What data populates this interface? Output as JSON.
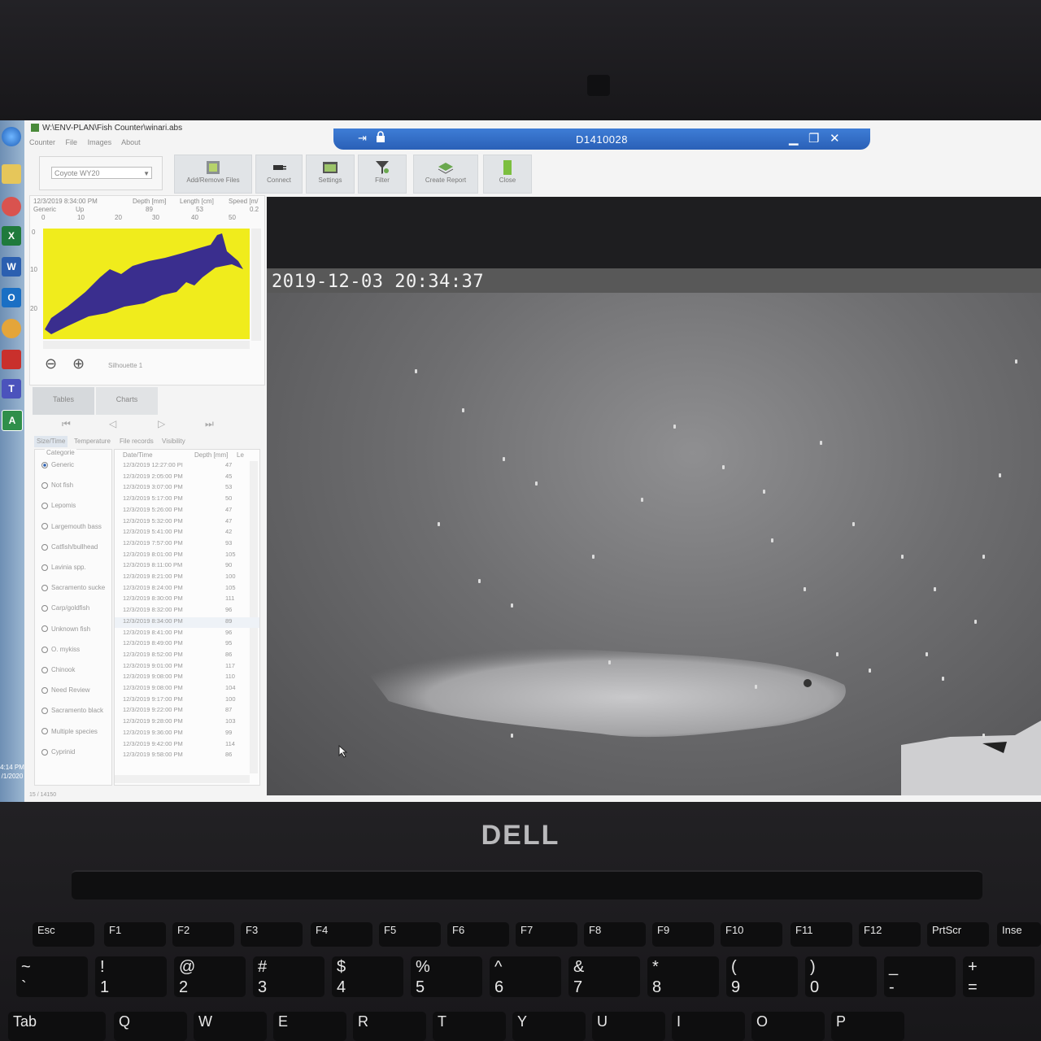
{
  "app": {
    "window_title": "W:\\ENV-PLAN\\Fish Counter\\winari.abs",
    "menu": [
      "Counter",
      "File",
      "Images",
      "About"
    ]
  },
  "remote_session": {
    "title": "D1410028"
  },
  "toolbar": {
    "site_select": "Coyote WY20",
    "buttons": [
      "Add/Remove Files",
      "Connect",
      "Settings",
      "Filter",
      "Create Report",
      "Close"
    ]
  },
  "preview": {
    "timestamp": "12/3/2019 8:34:00 PM",
    "direction_label": "Generic",
    "direction_value": "Up",
    "depth_label": "Depth [mm]",
    "depth_value": "89",
    "length_label": "Length [cm]",
    "length_value": "53",
    "speed_label": "Speed [m/",
    "speed_value": "0.2",
    "x_ticks": [
      "0",
      "10",
      "20",
      "30",
      "40",
      "50"
    ],
    "y_ticks": [
      "0",
      "10",
      "20"
    ],
    "silhouette_label": "Silhouette 1",
    "silhouette_fill": "#f0ec1c",
    "silhouette_shape": "#3a2e8e"
  },
  "view_tabs": [
    "Tables",
    "Charts"
  ],
  "sub_tabs": [
    "Size/Time",
    "Temperature",
    "File records",
    "Visibility"
  ],
  "category": {
    "title": "Categorie",
    "items": [
      "Generic",
      "Not fish",
      "Lepomis",
      "Largemouth bass",
      "Catfish/bullhead",
      "Lavinia spp.",
      "Sacramento sucke",
      "Carp/goldfish",
      "Unknown fish",
      "O. mykiss",
      "Chinook",
      "Need Review",
      "Sacramento black",
      "Multiple species",
      "Cyprinid"
    ],
    "selected": "Generic"
  },
  "records": {
    "columns": [
      "Date/Time",
      "Depth [mm]",
      "Le"
    ],
    "rows": [
      {
        "t": "12/3/2019 12:27:00 PI",
        "d": "47"
      },
      {
        "t": "12/3/2019 2:05:00 PM",
        "d": "45"
      },
      {
        "t": "12/3/2019 3:07:00 PM",
        "d": "53"
      },
      {
        "t": "12/3/2019 5:17:00 PM",
        "d": "50"
      },
      {
        "t": "12/3/2019 5:26:00 PM",
        "d": "47"
      },
      {
        "t": "12/3/2019 5:32:00 PM",
        "d": "47"
      },
      {
        "t": "12/3/2019 5:41:00 PM",
        "d": "42"
      },
      {
        "t": "12/3/2019 7:57:00 PM",
        "d": "93"
      },
      {
        "t": "12/3/2019 8:01:00 PM",
        "d": "105"
      },
      {
        "t": "12/3/2019 8:11:00 PM",
        "d": "90"
      },
      {
        "t": "12/3/2019 8:21:00 PM",
        "d": "100"
      },
      {
        "t": "12/3/2019 8:24:00 PM",
        "d": "105"
      },
      {
        "t": "12/3/2019 8:30:00 PM",
        "d": "111"
      },
      {
        "t": "12/3/2019 8:32:00 PM",
        "d": "96"
      },
      {
        "t": "12/3/2019 8:34:00 PM",
        "d": "89"
      },
      {
        "t": "12/3/2019 8:41:00 PM",
        "d": "96"
      },
      {
        "t": "12/3/2019 8:49:00 PM",
        "d": "95"
      },
      {
        "t": "12/3/2019 8:52:00 PM",
        "d": "86"
      },
      {
        "t": "12/3/2019 9:01:00 PM",
        "d": "117"
      },
      {
        "t": "12/3/2019 9:08:00 PM",
        "d": "110"
      },
      {
        "t": "12/3/2019 9:08:00 PM",
        "d": "104"
      },
      {
        "t": "12/3/2019 9:17:00 PM",
        "d": "100"
      },
      {
        "t": "12/3/2019 9:22:00 PM",
        "d": "87"
      },
      {
        "t": "12/3/2019 9:28:00 PM",
        "d": "103"
      },
      {
        "t": "12/3/2019 9:36:00 PM",
        "d": "99"
      },
      {
        "t": "12/3/2019 9:42:00 PM",
        "d": "114"
      },
      {
        "t": "12/3/2019 9:58:00 PM",
        "d": "86"
      }
    ]
  },
  "status_bar": "15 / 14150",
  "video": {
    "timestamp": "2019-12-03 20:34:37"
  },
  "taskbar": {
    "clock_time": "4:14 PM",
    "clock_date": "/1/2020"
  },
  "laptop": {
    "brand": "DELL"
  },
  "keyboard": {
    "fn_row": [
      "Esc",
      "F1",
      "F2",
      "F3",
      "F4",
      "F5",
      "F6",
      "F7",
      "F8",
      "F9",
      "F10",
      "F11",
      "F12",
      "PrtScr",
      "Inse"
    ],
    "num_row": [
      [
        "~",
        "`"
      ],
      [
        "!",
        "1"
      ],
      [
        "@",
        "2"
      ],
      [
        "#",
        "3"
      ],
      [
        "$",
        "4"
      ],
      [
        "%",
        "5"
      ],
      [
        "^",
        "6"
      ],
      [
        "&",
        "7"
      ],
      [
        "*",
        "8"
      ],
      [
        "(",
        "9"
      ],
      [
        ")",
        "0"
      ],
      [
        "_",
        "-"
      ],
      [
        "+",
        "="
      ]
    ],
    "letter_row": [
      "Tab",
      "Q",
      "W",
      "E",
      "R",
      "T",
      "Y",
      "U",
      "I",
      "O",
      "P"
    ]
  }
}
